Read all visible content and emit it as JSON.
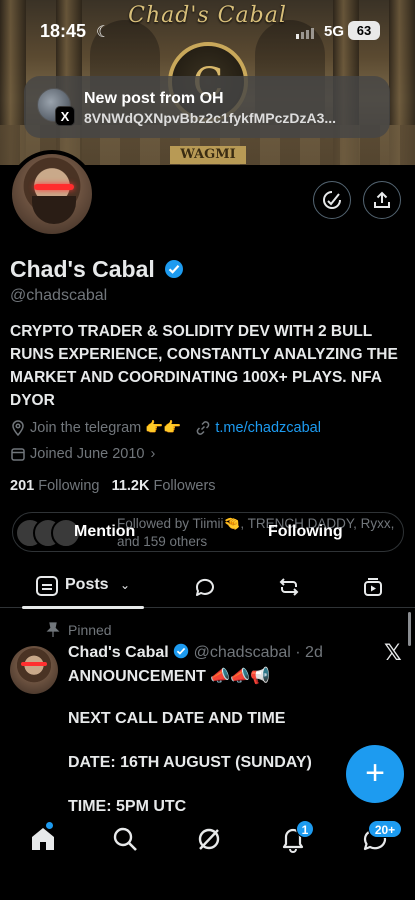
{
  "status_bar": {
    "time": "18:45",
    "network": "5G",
    "battery": "63"
  },
  "banner": {
    "title": "Chad's Cabal",
    "emblem_letter": "C",
    "ribbon": "WAGMI"
  },
  "notification": {
    "title": "New post from OH",
    "body": "8VNWdQXNpvBbz2c1fykfMPczDzA3...",
    "app_badge": "X"
  },
  "profile": {
    "name": "Chad's Cabal",
    "handle": "@chadscabal",
    "bio": "CRYPTO TRADER & SOLIDITY DEV WITH 2 BULL RUNS EXPERIENCE, CONSTANTLY ANALYZING THE MARKET AND COORDINATING 100X+ PLAYS. NFA DYOR",
    "location": "Join the telegram 👉👉",
    "link": "t.me/chadzcabal",
    "joined": "Joined June 2010",
    "following_count": "201",
    "following_label": "Following",
    "followers_count": "11.2K",
    "followers_label": "Followers",
    "followed_by": "Followed by Tiimii🤏, TRENCH DADDY, Ryxx, and 159 others",
    "mention_label": "Mention",
    "following_button": "Following"
  },
  "tabs": {
    "posts_label": "Posts"
  },
  "post": {
    "pinned_label": "Pinned",
    "author_name": "Chad's Cabal",
    "author_handle": "@chadscabal",
    "time": "· 2d",
    "line1": "ANNOUNCEMENT 📣📣📢",
    "line2": "NEXT CALL DATE AND TIME",
    "line3": "DATE: 16TH AUGUST (SUNDAY)",
    "line4": "TIME: 5PM UTC"
  },
  "fab": {
    "label": "+"
  },
  "bottom_nav": {
    "notifications_badge": "1",
    "messages_badge": "20+"
  },
  "colors": {
    "accent": "#1d9bf0",
    "background": "#000000",
    "text": "#e7e9ea",
    "muted": "#71767b"
  }
}
